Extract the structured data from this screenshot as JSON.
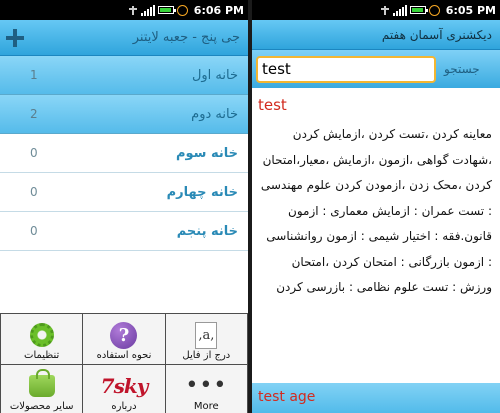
{
  "left": {
    "status": {
      "time": "6:06 PM"
    },
    "title": "جی پنج - جعبه لایتنر",
    "rows": [
      {
        "name": "خانه اول",
        "count": "1",
        "selected": true
      },
      {
        "name": "خانه دوم",
        "count": "2",
        "selected": true
      },
      {
        "name": "خانه سوم",
        "count": "0",
        "selected": false
      },
      {
        "name": "خانه چهارم",
        "count": "0",
        "selected": false
      },
      {
        "name": "خانه پنجم",
        "count": "0",
        "selected": false
      }
    ],
    "menu": {
      "settings": "تنظیمات",
      "help": "نحوه استفاده",
      "import": "درج از فایل",
      "other_products": "سایر محصولات",
      "about": "درباره",
      "more": "More"
    },
    "brand_logo": "7sky"
  },
  "right": {
    "status": {
      "time": "6:05 PM"
    },
    "title": "دیکشنری آسمان هفتم",
    "search": {
      "label": "جستجو",
      "value": "test"
    },
    "result_word": "test",
    "definition": "معاینه کردن ،تست کردن ،ازمایش کردن ،شهادت گواهی ،ازمون ،ازمایش ،معیار،امتحان کردن ،محک زدن ،ازمودن کردن علوم مهندسی : تست عمران : ازمایش معماری : ازمون قانون.فقه : اختیار شیمی : ازمون روانشناسی : ازمون بازرگانی : امتحان کردن ،امتحان ورزش : تست علوم نظامی : بازرسی کردن",
    "next_word": "test age"
  },
  "colors": {
    "accent_blue": "#2fa4dc",
    "word_red": "#d22b1f",
    "search_border": "#f2b632"
  }
}
